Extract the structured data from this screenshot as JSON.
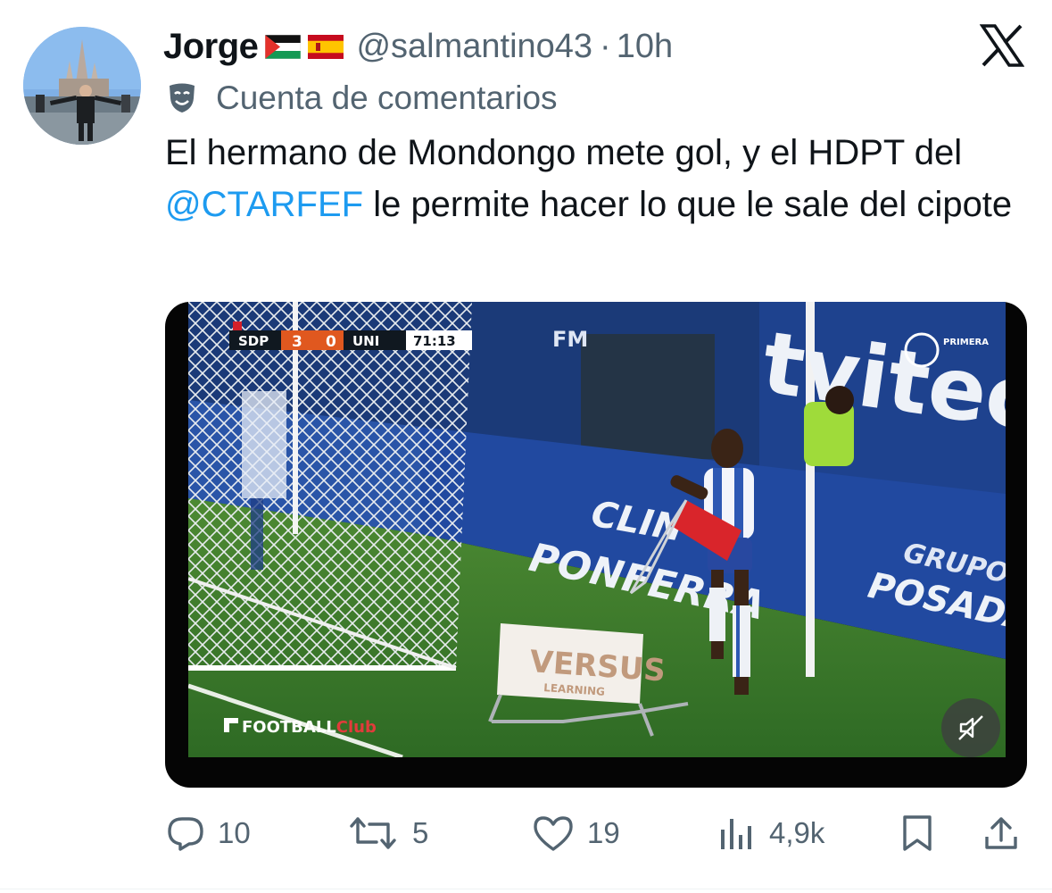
{
  "tweet": {
    "author": {
      "name": "Jorge",
      "handle": "@salmantino43",
      "separator": "·",
      "time": "10h"
    },
    "label": "Cuenta de comentarios",
    "text_before_mention": "El hermano de Mondongo mete gol, y el HDPT del ",
    "mention": "@CTARFEF",
    "text_after_mention": " le permite hacer lo que le sale del cipote"
  },
  "video": {
    "scorebug": {
      "home": "SDP",
      "home_score": "3",
      "away_score": "0",
      "away": "UNI",
      "clock": "71:13"
    },
    "broadcaster": "FOOTBALL",
    "broadcaster_suffix": "Club",
    "league_logo": "PRIMERA",
    "ad_board_1": "Clínica Ponferrada",
    "ad_board_1a": "CLIN",
    "ad_board_1b": "PONFERRA",
    "ad_board_2": "GRUPO",
    "ad_board_2b": "POSADA",
    "ad_board_3": "tvitec",
    "sign": "VERSUS",
    "sign_sub": "LEARNING",
    "radio": "FM",
    "muted": true
  },
  "actions": {
    "replies": "10",
    "reposts": "5",
    "likes": "19",
    "views": "4,9k"
  },
  "colors": {
    "text": "#0f1419",
    "secondary": "#536471",
    "link": "#1d9bf0",
    "pitch": "#3c7a2e",
    "boards": "#1f3f86"
  },
  "icons": {
    "reply": "speech-bubble-icon",
    "repost": "repost-arrows-icon",
    "like": "heart-icon",
    "views": "bar-chart-icon",
    "bookmark": "bookmark-icon",
    "share": "share-upload-icon",
    "platform": "x-logo-icon",
    "label": "theater-mask-icon",
    "mute": "speaker-muted-icon"
  }
}
